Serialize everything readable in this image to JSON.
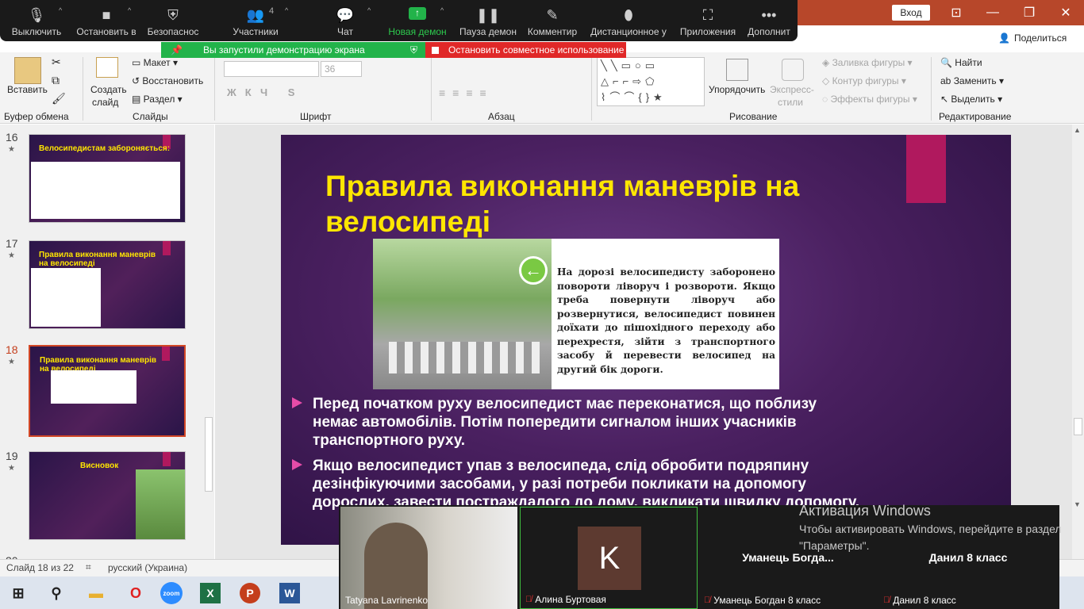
{
  "window": {
    "login_label": "Вход",
    "share_label": "Поделиться"
  },
  "zoom_toolbar": {
    "items": [
      {
        "label": "Выключить",
        "icon": "mic-icon"
      },
      {
        "label": "Остановить в",
        "icon": "video-icon"
      },
      {
        "label": "Безопаснос",
        "icon": "shield-icon"
      },
      {
        "label": "Участники",
        "icon": "participants-icon",
        "count": "4"
      },
      {
        "label": "Чат",
        "icon": "chat-icon"
      },
      {
        "label": "Новая демон",
        "icon": "share-screen-icon"
      },
      {
        "label": "Пауза демон",
        "icon": "pause-icon"
      },
      {
        "label": "Комментир",
        "icon": "pen-icon"
      },
      {
        "label": "Дистанционное у",
        "icon": "mouse-icon"
      },
      {
        "label": "Приложения",
        "icon": "apps-icon"
      },
      {
        "label": "Дополнит",
        "icon": "more-icon"
      }
    ]
  },
  "banner": {
    "sharing_text": "Вы запустили демонстрацию экрана",
    "stop_text": "Остановить совместное использование"
  },
  "ribbon": {
    "clipboard": {
      "paste": "Вставить",
      "label": "Буфер обмена"
    },
    "slides": {
      "create": "Создать",
      "create2": "слайд",
      "layout": "Макет",
      "reset": "Восстановить",
      "section": "Раздел",
      "label": "Слайды"
    },
    "font": {
      "size": "36",
      "label": "Шрифт"
    },
    "paragraph": {
      "label": "Абзац"
    },
    "drawing": {
      "arrange": "Упорядочить",
      "styles": "Экспресс-",
      "styles2": "стили",
      "fill": "Заливка фигуры",
      "outline": "Контур фигуры",
      "effects": "Эффекты фигуры",
      "label": "Рисование"
    },
    "editing": {
      "find": "Найти",
      "replace": "Заменить",
      "select": "Выделить",
      "label": "Редактирование"
    }
  },
  "thumbnails": [
    {
      "num": "16",
      "title": "Велосипедистам забороняється:"
    },
    {
      "num": "17",
      "title": "Правила виконання маневрів на велосипеді"
    },
    {
      "num": "18",
      "title": "Правила виконання маневрів на велосипеді"
    },
    {
      "num": "19",
      "title": "Висновок"
    },
    {
      "num": "20",
      "title": ""
    }
  ],
  "slide": {
    "title": "Правила виконання маневрів на велосипеді",
    "image_text": "На дорозі велосипедисту заборонено повороти ліворуч і розвороти. Якщо треба повернути ліворуч або розвернутися, велосипедист повинен доїхати до пішохідного переходу або перехрестя, зійти з транспортного засобу й перевести велосипед на другий бік дороги.",
    "bullet1": "Перед початком руху велосипедист має переконатися, що поблизу немає автомобілів. Потім попередити сигналом інших учасників транспортного руху.",
    "bullet2": "Якщо велосипедист упав з велосипеда, слід обробити подряпину дезінфікуючими засобами, у разі потреби покликати на допомогу дорослих, завести постраждалого до дому, викликати швидку допомогу."
  },
  "statusbar": {
    "slide_info": "Слайд 18 из 22",
    "language": "русский (Украина)"
  },
  "videos": [
    {
      "name": "Tatyana Lavrinenko",
      "type": "camera"
    },
    {
      "name": "Алина Буртовая",
      "avatar_letter": "K",
      "muted": true
    },
    {
      "name": "Уманець Богдан 8 класс",
      "display": "Уманець  Богда...",
      "muted": true
    },
    {
      "name": "Данил 8 класс",
      "display": "Данил 8 класс",
      "muted": true
    }
  ],
  "activation": {
    "title": "Активация Windows",
    "subtitle": "Чтобы активировать Windows, перейдите в раздел \"Параметры\"."
  },
  "colors": {
    "accent": "#b7472a",
    "title_yellow": "#ffe600",
    "pink": "#b0195e",
    "zoom_green": "#22b34a",
    "zoom_red": "#e02828"
  }
}
